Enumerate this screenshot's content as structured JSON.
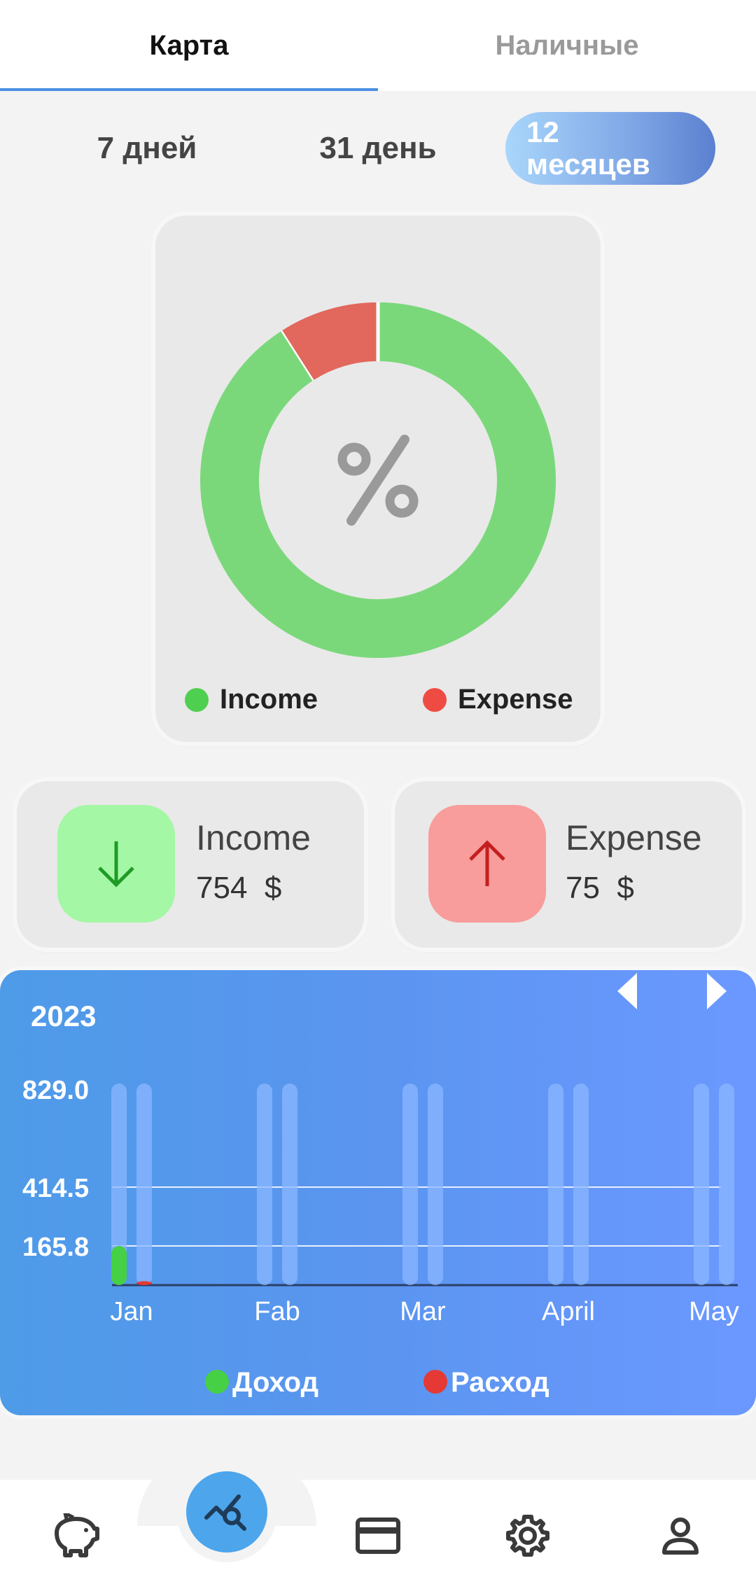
{
  "tabs": [
    {
      "label": "Карта",
      "active": true
    },
    {
      "label": "Наличные",
      "active": false
    }
  ],
  "period": {
    "options": [
      "7 дней",
      "31 день",
      "12\nмесяцев"
    ],
    "selected": "12\nмесяцев"
  },
  "donut": {
    "center_icon": "percent-icon",
    "slices": [
      {
        "name": "Income",
        "value": 754,
        "color": "#7ad87a"
      },
      {
        "name": "Expense",
        "value": 75,
        "color": "#e2675c"
      }
    ],
    "legend": [
      {
        "label": "Income",
        "color": "#4fcf4f"
      },
      {
        "label": "Expense",
        "color": "#ee4c43"
      }
    ]
  },
  "stats": {
    "income": {
      "label": "Income",
      "value": "754",
      "currency": "$",
      "icon": "arrow-down-icon",
      "bg": "#a4f7a4",
      "icon_color": "#1f9b25"
    },
    "expense": {
      "label": "Expense",
      "value": "75",
      "currency": "$",
      "icon": "arrow-up-icon",
      "bg": "#f89c9c",
      "icon_color": "#c51e1e"
    }
  },
  "chart_data": {
    "type": "bar",
    "year": "2023",
    "categories": [
      "Jan",
      "Fab",
      "Mar",
      "April",
      "May"
    ],
    "y_ticks": [
      "829.0",
      "414.5",
      "165.8"
    ],
    "ylim": [
      0,
      829
    ],
    "series": [
      {
        "name": "Доход",
        "color": "#45d045",
        "values": [
          165.8,
          0,
          0,
          0,
          0
        ]
      },
      {
        "name": "Расход",
        "color": "#e53935",
        "values": [
          16.6,
          0,
          0,
          0,
          0
        ]
      }
    ],
    "legend": [
      {
        "label": "Доход",
        "color": "#45d045"
      },
      {
        "label": "Расход",
        "color": "#e53935"
      }
    ]
  },
  "bottom_nav": {
    "items": [
      "piggy-bank-icon",
      "analytics-icon",
      "card-icon",
      "settings-icon",
      "profile-icon"
    ],
    "active": "analytics-icon"
  }
}
